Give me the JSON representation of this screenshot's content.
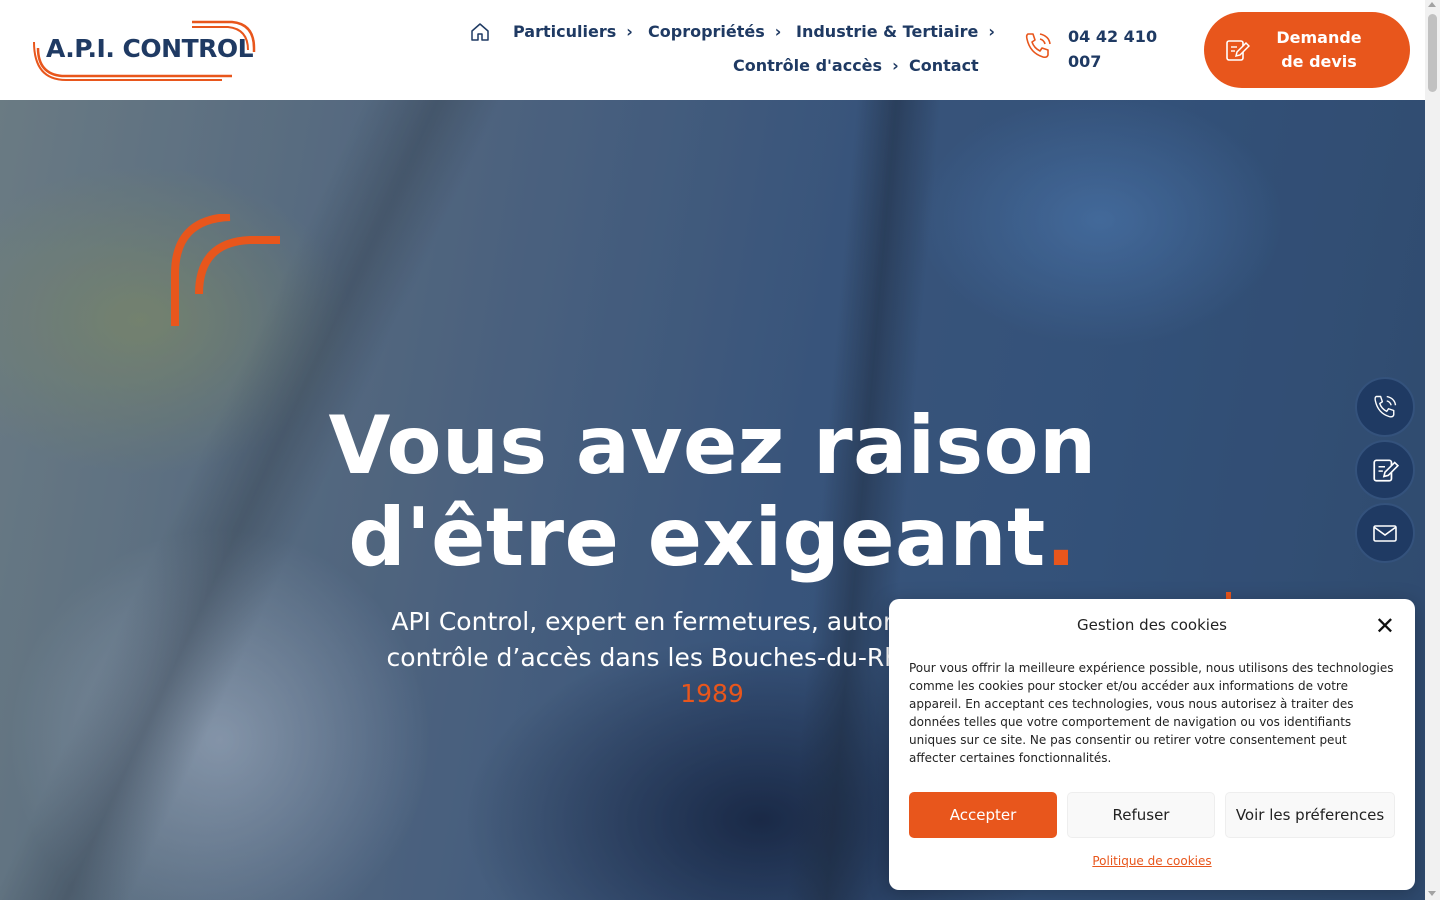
{
  "header": {
    "logo_text_main": "A.P.I. CONTROL",
    "nav": {
      "home_icon": "home-icon",
      "particuliers": "Particuliers",
      "coproprietes": "Copropriétés",
      "industrie": "Industrie & Tertiaire",
      "controle": "Contrôle d'accès",
      "contact": "Contact"
    },
    "phone": "04 42 410 007",
    "devis_label": "Demande de devis"
  },
  "hero": {
    "title_line1": "Vous avez raison",
    "title_line2": "d'être exigeant",
    "title_dot": ".",
    "subtitle_main": "API Control, expert en fermetures, automatismes & contrôle d’accès dans les Bouches-du-Rhône ",
    "subtitle_highlight": "depuis 1989"
  },
  "side_buttons": [
    "phone-icon",
    "quote-edit-icon",
    "mail-icon"
  ],
  "cookie": {
    "title": "Gestion des cookies",
    "text": "Pour vous offrir la meilleure expérience possible, nous utilisons des technologies comme les cookies pour stocker et/ou accéder aux informations de votre appareil. En acceptant ces technologies, vous nous autorisez à traiter des données telles que votre comportement de navigation ou vos identifiants uniques sur ce site. Ne pas consentir ou retirer votre consentement peut affecter certaines fonctionnalités.",
    "accept": "Accepter",
    "refuse": "Refuser",
    "prefs": "Voir les préferences",
    "policy_link": "Politique de cookies"
  },
  "colors": {
    "brand_orange": "#e8561c",
    "brand_navy": "#1f3a63"
  }
}
